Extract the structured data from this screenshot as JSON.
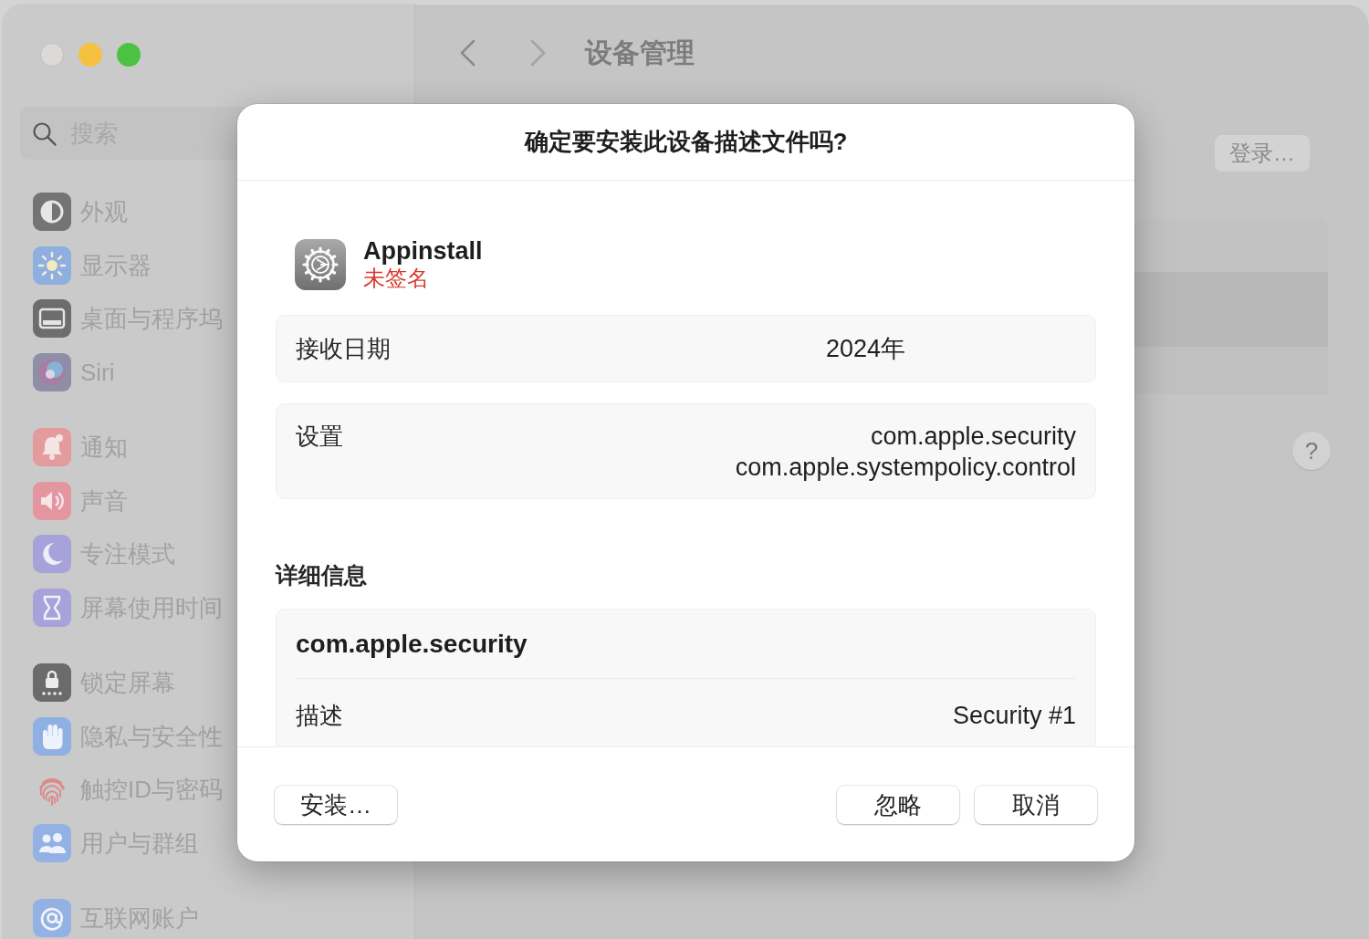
{
  "window": {
    "buttons": [
      {
        "kind": "close",
        "disabled": true
      },
      {
        "kind": "minimize",
        "disabled": false
      },
      {
        "kind": "zoom",
        "disabled": false
      }
    ]
  },
  "sidebar": {
    "search": {
      "placeholder": "搜索"
    },
    "groups": [
      {
        "items": [
          {
            "label": "外观",
            "kind": "appearance"
          },
          {
            "label": "显示器",
            "kind": "displays"
          },
          {
            "label": "桌面与程序坞",
            "kind": "desktop"
          },
          {
            "label": "Siri",
            "kind": "siri"
          }
        ]
      },
      {
        "items": [
          {
            "label": "通知",
            "kind": "notifications"
          },
          {
            "label": "声音",
            "kind": "sound"
          },
          {
            "label": "专注模式",
            "kind": "focus"
          },
          {
            "label": "屏幕使用时间",
            "kind": "screentime"
          }
        ]
      },
      {
        "items": [
          {
            "label": "锁定屏幕",
            "kind": "lockscreen"
          },
          {
            "label": "隐私与安全性",
            "kind": "privacy"
          },
          {
            "label": "触控ID与密码",
            "kind": "touchid"
          },
          {
            "label": "用户与群组",
            "kind": "users"
          }
        ]
      },
      {
        "items": [
          {
            "label": "互联网账户",
            "kind": "accounts"
          }
        ]
      }
    ]
  },
  "toolbar": {
    "title": "设备管理"
  },
  "content": {
    "login_button": "登录…",
    "help_button": "?"
  },
  "dialog": {
    "title": "确定要安装此设备描述文件吗?",
    "profile": {
      "name": "Appinstall",
      "status": "未签名"
    },
    "summary": [
      {
        "kind": "date",
        "label": "接收日期",
        "values": [
          "2024年"
        ]
      },
      {
        "kind": "list",
        "label": "设置",
        "values": [
          "com.apple.security",
          "com.apple.systempolicy.control"
        ]
      }
    ],
    "details_heading": "详细信息",
    "details": [
      {
        "title": "com.apple.security",
        "rows": [
          {
            "label": "描述",
            "value": "Security #1"
          }
        ]
      }
    ],
    "footer": {
      "left_buttons": [
        "安装…"
      ],
      "right_buttons": [
        "忽略",
        "取消"
      ]
    }
  }
}
